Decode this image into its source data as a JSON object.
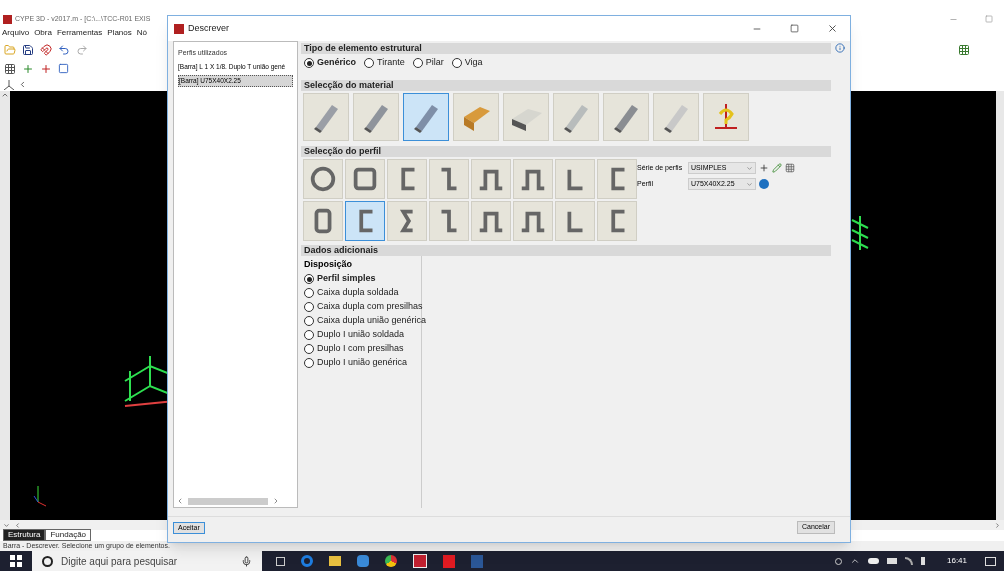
{
  "app": {
    "title": "CYPE 3D - v2017.m - [C:\\...\\TCC-R01 EXIS",
    "menu": [
      "Arquivo",
      "Obra",
      "Ferramentas",
      "Planos",
      "Nó"
    ],
    "tabs": [
      {
        "label": "Estrutura",
        "selected": true
      },
      {
        "label": "Fundação",
        "selected": false
      }
    ],
    "status_bar": "Barra - Descrever.  Selecione um grupo de elementos."
  },
  "dialog": {
    "title": "Descrever",
    "list": {
      "header": "Perfis utilizados",
      "items": [
        {
          "label": "[Barra] L 1 X 1/8. Duplo T união gené",
          "selected": false
        },
        {
          "label": "[Barra] U75X40X2.25",
          "selected": true
        }
      ]
    },
    "element_type": {
      "heading": "Tipo de elemento estrutural",
      "options": [
        {
          "label": "Genérico",
          "selected": true
        },
        {
          "label": "Tirante",
          "selected": false
        },
        {
          "label": "Pilar",
          "selected": false
        },
        {
          "label": "Viga",
          "selected": false
        }
      ]
    },
    "material": {
      "heading": "Selecção do material",
      "tiles": [
        {
          "selected": false
        },
        {
          "selected": false
        },
        {
          "selected": true
        },
        {
          "selected": false
        },
        {
          "selected": false
        },
        {
          "selected": false
        },
        {
          "selected": false
        },
        {
          "selected": false
        },
        {
          "selected": false
        }
      ]
    },
    "profile": {
      "heading": "Selecção do perfil",
      "tiles": [
        {
          "selected": false
        },
        {
          "selected": false
        },
        {
          "selected": false
        },
        {
          "selected": false
        },
        {
          "selected": false
        },
        {
          "selected": false
        },
        {
          "selected": false
        },
        {
          "selected": false
        },
        {
          "selected": false
        },
        {
          "selected": true
        },
        {
          "selected": false
        },
        {
          "selected": false
        },
        {
          "selected": false
        },
        {
          "selected": false
        },
        {
          "selected": false
        },
        {
          "selected": false
        }
      ],
      "series_label": "Série de perfis",
      "series_value": "USIMPLES",
      "profile_label": "Perfil",
      "profile_value": "U75X40X2.25"
    },
    "additional": {
      "heading": "Dados adicionais",
      "subheading": "Disposição",
      "options": [
        {
          "label": "Perfil simples",
          "selected": true
        },
        {
          "label": "Caixa dupla soldada",
          "selected": false
        },
        {
          "label": "Caixa dupla com presilhas",
          "selected": false
        },
        {
          "label": "Caixa dupla união genérica",
          "selected": false
        },
        {
          "label": "Duplo I união soldada",
          "selected": false
        },
        {
          "label": "Duplo I com presilhas",
          "selected": false
        },
        {
          "label": "Duplo I união genérica",
          "selected": false
        }
      ]
    },
    "buttons": [
      "Aceitar",
      "Cancelar"
    ]
  },
  "taskbar": {
    "search_placeholder": "Digite aqui para pesquisar",
    "time": "16:41"
  }
}
